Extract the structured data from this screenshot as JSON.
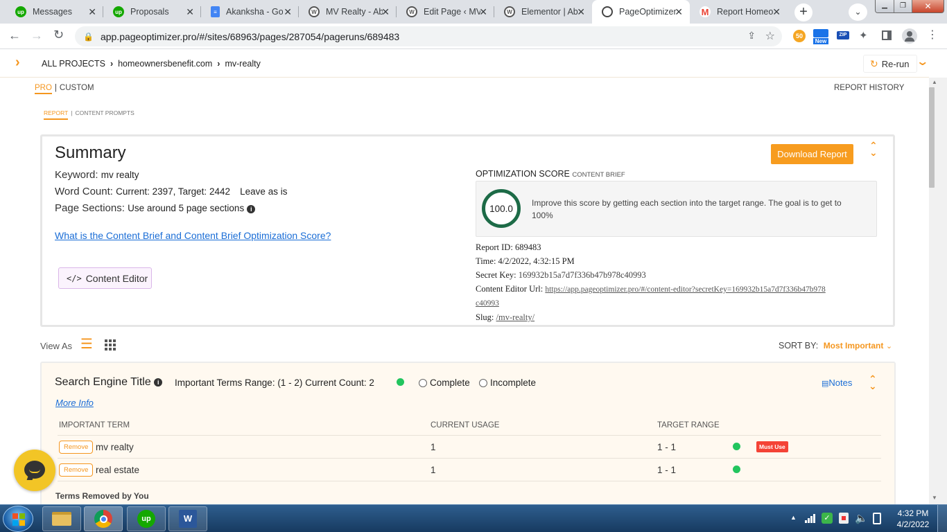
{
  "browser": {
    "tabs": [
      {
        "title": "Messages",
        "icon": "upwork-icon",
        "color": "#14a800"
      },
      {
        "title": "Proposals",
        "icon": "upwork-icon",
        "color": "#14a800"
      },
      {
        "title": "Akanksha - Go",
        "icon": "google-docs-icon",
        "color": "#4285f4"
      },
      {
        "title": "MV Realty - Ab",
        "icon": "wordpress-icon",
        "color": "#3c4043"
      },
      {
        "title": "Edit Page ‹ MV",
        "icon": "wordpress-icon",
        "color": "#3c4043"
      },
      {
        "title": "Elementor | Ab",
        "icon": "wordpress-icon",
        "color": "#3c4043"
      },
      {
        "title": "PageOptimizer",
        "icon": "pageoptimizer-icon",
        "color": "#3c4043"
      },
      {
        "title": "Report Homeo",
        "icon": "gmail-icon",
        "color": "#ea4335"
      }
    ],
    "url": "app.pageoptimizer.pro/#/sites/68963/pages/287054/pageruns/689483",
    "ext_new_badge": "New",
    "ext_zip_badge": "ZIP"
  },
  "header": {
    "breadcrumb": [
      "ALL PROJECTS",
      "homeownersbenefit.com",
      "mv-realty"
    ],
    "rerun_label": "Re-run"
  },
  "modes": {
    "pro": "PRO",
    "divider": "|",
    "custom": "CUSTOM",
    "report_history": "REPORT HISTORY"
  },
  "subtabs": {
    "report": "REPORT",
    "divider": "|",
    "content_prompts": "CONTENT PROMPTS"
  },
  "summary": {
    "title": "Summary",
    "keyword_label": "Keyword:",
    "keyword_value": "mv realty",
    "word_count_label": "Word Count:",
    "word_count_value": "Current: 2397, Target: 2442",
    "word_count_note": "Leave as is",
    "page_sections_label": "Page Sections:",
    "page_sections_value": "Use around 5 page sections",
    "brief_link": "What is the Content Brief and Content Brief Optimization Score?",
    "content_editor_label": "Content Editor",
    "download_label": "Download Report",
    "score_heading": "OPTIMIZATION SCORE",
    "score_subheading": "CONTENT BRIEF",
    "score_value": "100.0",
    "score_text": "Improve this score by getting each section into the target range. The goal is to get to 100%",
    "report_id_label": "Report ID:",
    "report_id": "689483",
    "time_label": "Time:",
    "time": "4/2/2022, 4:32:15 PM",
    "secret_key_label": "Secret Key:",
    "secret_key": "169932b15a7d7f336b47b978c40993",
    "editor_url_label": "Content Editor Url:",
    "editor_url_line1": "https://app.pageoptimizer.pro/#/content-editor?secretKey=169932b15a7d7f336b47b978",
    "editor_url_line2": "c40993",
    "slug_label": "Slug:",
    "slug": "/mv-realty/"
  },
  "viewbar": {
    "view_as": "View As",
    "sort_label": "SORT BY:",
    "sort_value": "Most Important"
  },
  "section": {
    "title": "Search Engine Title",
    "range_text": "Important Terms Range: (1 - 2) Current Count: 2",
    "status_color": "#22c55e",
    "complete_label": "Complete",
    "incomplete_label": "Incomplete",
    "notes_label": "Notes",
    "more_info": "More Info",
    "columns": [
      "IMPORTANT TERM",
      "CURRENT USAGE",
      "TARGET RANGE"
    ],
    "remove_label": "Remove",
    "must_use_label": "Must Use",
    "rows": [
      {
        "term": "mv realty",
        "usage": "1",
        "range": "1 - 1",
        "must_use": true
      },
      {
        "term": "real estate",
        "usage": "1",
        "range": "1 - 1",
        "must_use": false
      }
    ],
    "removed_heading": "Terms Removed by You"
  },
  "taskbar": {
    "time": "4:32 PM",
    "date": "4/2/2022"
  }
}
